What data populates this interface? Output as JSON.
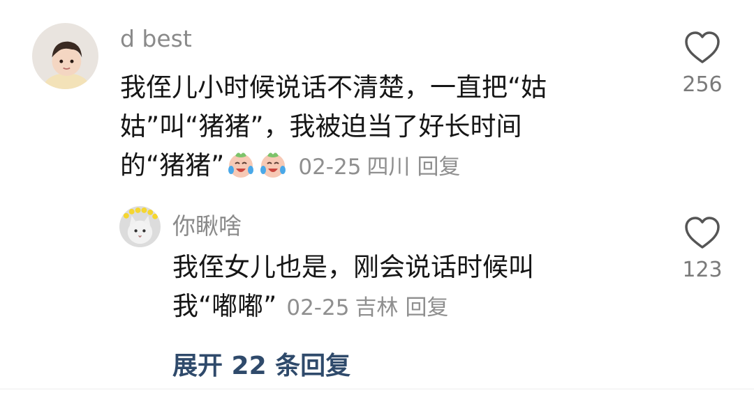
{
  "comment": {
    "username": "d best",
    "text_lines": [
      "我侄儿小时候说话不清楚，一直把“姑",
      "姑”叫“猪猪”，我被迫当了好长时间",
      "的“猪猪”"
    ],
    "emojis": [
      "crying-laughing-emoji",
      "crying-laughing-emoji"
    ],
    "date": "02-25",
    "location": "四川",
    "reply_label": "回复",
    "like_count": "256",
    "avatar": "child-photo-avatar"
  },
  "reply": {
    "username": "你瞅啥",
    "text_lines": [
      "我侄女儿也是，刚会说话时候叫",
      "我“嘟嘟”"
    ],
    "date": "02-25",
    "location": "吉林",
    "reply_label": "回复",
    "like_count": "123",
    "avatar": "cat-with-flower-crown-avatar"
  },
  "expand_replies_label": "展开 22 条回复",
  "colors": {
    "text": "#161616",
    "meta": "#8f8f8f",
    "username": "#8a8a8a",
    "expand_link": "#2f4a6b",
    "like_icon": "#555555"
  }
}
